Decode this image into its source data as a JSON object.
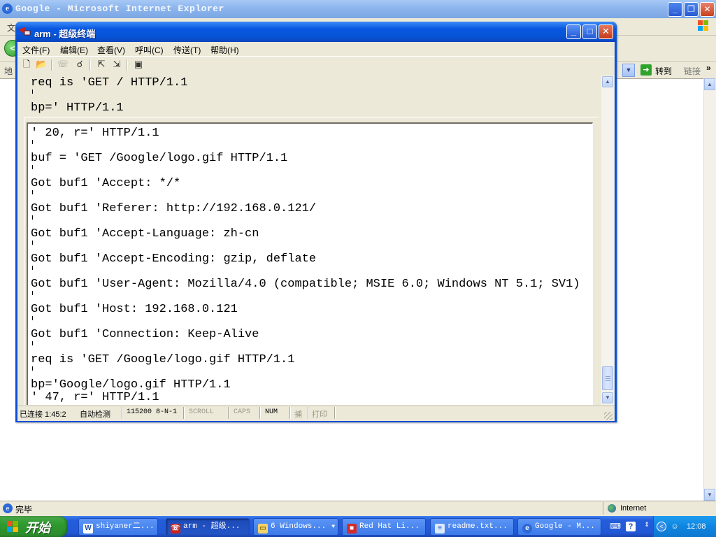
{
  "ie": {
    "title": "Google - Microsoft Internet Explorer",
    "menu_partial": "文",
    "address_partial": "地",
    "go_label": "转到",
    "links_label": "链接",
    "status_text": "完毕",
    "zone_text": "Internet"
  },
  "terminal": {
    "title": "arm - 超级终端",
    "menu": [
      "文件(F)",
      "编辑(E)",
      "查看(V)",
      "呼叫(C)",
      "传送(T)",
      "帮助(H)"
    ],
    "lines_upper": [
      "req is 'GET / HTTP/1.1",
      "bp=' HTTP/1.1"
    ],
    "lines": [
      "' 20, r=' HTTP/1.1",
      "buf = 'GET /Google/logo.gif HTTP/1.1",
      "Got buf1 'Accept: */*",
      "Got buf1 'Referer: http://192.168.0.121/",
      "Got buf1 'Accept-Language: zh-cn",
      "Got buf1 'Accept-Encoding: gzip, deflate",
      "Got buf1 'User-Agent: Mozilla/4.0 (compatible; MSIE 6.0; Windows NT 5.1; SV1)",
      "Got buf1 'Host: 192.168.0.121",
      "Got buf1 'Connection: Keep-Alive",
      "req is 'GET /Google/logo.gif HTTP/1.1",
      "bp='Google/logo.gif HTTP/1.1",
      "' 47, r=' HTTP/1.1"
    ],
    "status": {
      "connected": "已连接 1:45:2",
      "detect": "自动检测",
      "port": "115200 8-N-1",
      "scroll": "SCROLL",
      "caps": "CAPS",
      "num": "NUM",
      "capture": "捕",
      "print": "打印"
    }
  },
  "taskbar": {
    "start_label": "开始",
    "tasks": [
      {
        "label": "shiyaner二...",
        "icon": "word-icon"
      },
      {
        "label": "arm - 超级...",
        "icon": "hyperterminal-icon"
      },
      {
        "label": "6 Windows...",
        "icon": "folder-icon"
      },
      {
        "label": "Red Hat Li...",
        "icon": "red-hat-icon"
      },
      {
        "label": "readme.txt...",
        "icon": "notepad-icon"
      },
      {
        "label": "Google - M...",
        "icon": "ie-icon"
      }
    ],
    "clock": "12:08"
  },
  "colors": {
    "xp_blue": "#0655d8",
    "xp_face": "#ece9d8",
    "start_green": "#2f9a2f",
    "tray_blue": "#0f86e0"
  }
}
